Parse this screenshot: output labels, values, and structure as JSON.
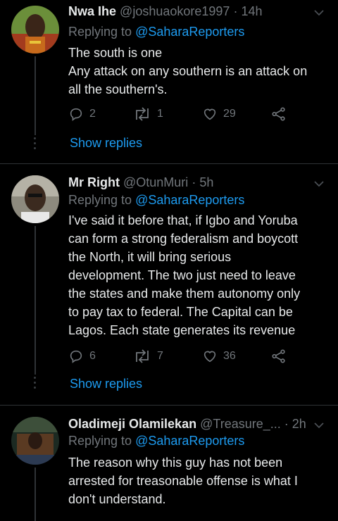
{
  "tweets": [
    {
      "name": "Nwa Ihe",
      "handle": "@joshuaokore1997",
      "time": "14h",
      "sep": "·",
      "replying_prefix": "Replying to ",
      "replying_handle": "@SaharaReporters",
      "text_lines": [
        "The south is one",
        "Any attack on any southern is an attack on",
        "all the southern's."
      ],
      "replies": "2",
      "retweets": "1",
      "likes": "29",
      "show_replies": "Show replies"
    },
    {
      "name": "Mr Right",
      "handle": "@OtunMuri",
      "time": "5h",
      "sep": "·",
      "replying_prefix": "Replying to ",
      "replying_handle": "@SaharaReporters",
      "text_lines": [
        "I've said it before that, if Igbo and Yoruba",
        "can form a strong federalism and boycott",
        "the North, it will bring serious",
        "development. The two just need to leave",
        "the states and make them autonomy only",
        "to pay tax to federal. The Capital can be",
        "Lagos. Each state generates its revenue"
      ],
      "replies": "6",
      "retweets": "7",
      "likes": "36",
      "show_replies": "Show replies"
    },
    {
      "name": "Oladimeji Olamilekan",
      "handle": "@Treasure_...",
      "time": "2h",
      "sep": "·",
      "replying_prefix": "Replying to ",
      "replying_handle": "@SaharaReporters",
      "text_lines": [
        "The reason why this guy has not been",
        "arrested for treasonable offense is what I",
        "don't understand."
      ]
    }
  ],
  "icons": {
    "reply": "reply-icon",
    "retweet": "retweet-icon",
    "like": "heart-icon",
    "share": "share-icon",
    "more": "chevron-down-icon"
  },
  "colors": {
    "background": "#000000",
    "accent": "#1d9bf0",
    "muted": "#71767b",
    "text": "#e7e9ea"
  }
}
